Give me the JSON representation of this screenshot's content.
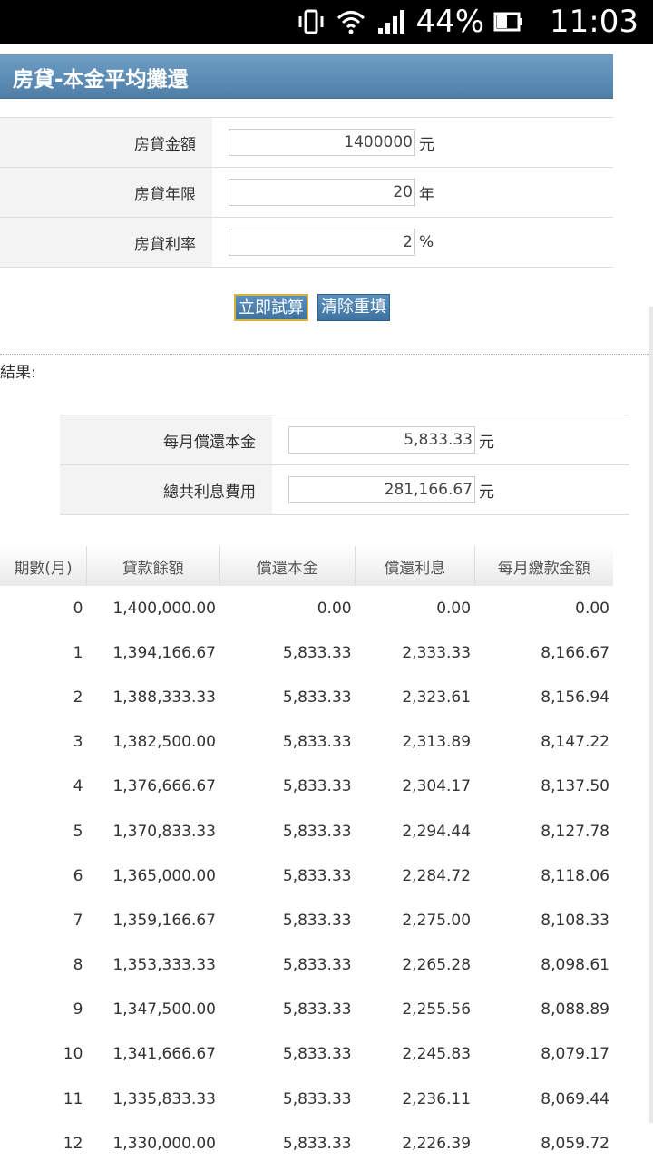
{
  "status": {
    "battery": "44%",
    "time": "11:03"
  },
  "title": "房貸-本金平均攤還",
  "form": [
    {
      "label": "房貸金額",
      "value": "1400000",
      "unit": "元"
    },
    {
      "label": "房貸年限",
      "value": "20",
      "unit": "年"
    },
    {
      "label": "房貸利率",
      "value": "2",
      "unit": "%"
    }
  ],
  "buttons": {
    "calculate": "立即試算",
    "clear": "清除重填"
  },
  "result_label": "結果:",
  "results": [
    {
      "label": "每月償還本金",
      "value": "5,833.33",
      "unit": "元"
    },
    {
      "label": "總共利息費用",
      "value": "281,166.67",
      "unit": "元"
    }
  ],
  "schedule": {
    "headers": [
      "期數(月)",
      "貸款餘額",
      "償還本金",
      "償還利息",
      "每月繳款金額"
    ],
    "rows": [
      [
        "0",
        "1,400,000.00",
        "0.00",
        "0.00",
        "0.00"
      ],
      [
        "1",
        "1,394,166.67",
        "5,833.33",
        "2,333.33",
        "8,166.67"
      ],
      [
        "2",
        "1,388,333.33",
        "5,833.33",
        "2,323.61",
        "8,156.94"
      ],
      [
        "3",
        "1,382,500.00",
        "5,833.33",
        "2,313.89",
        "8,147.22"
      ],
      [
        "4",
        "1,376,666.67",
        "5,833.33",
        "2,304.17",
        "8,137.50"
      ],
      [
        "5",
        "1,370,833.33",
        "5,833.33",
        "2,294.44",
        "8,127.78"
      ],
      [
        "6",
        "1,365,000.00",
        "5,833.33",
        "2,284.72",
        "8,118.06"
      ],
      [
        "7",
        "1,359,166.67",
        "5,833.33",
        "2,275.00",
        "8,108.33"
      ],
      [
        "8",
        "1,353,333.33",
        "5,833.33",
        "2,265.28",
        "8,098.61"
      ],
      [
        "9",
        "1,347,500.00",
        "5,833.33",
        "2,255.56",
        "8,088.89"
      ],
      [
        "10",
        "1,341,666.67",
        "5,833.33",
        "2,245.83",
        "8,079.17"
      ],
      [
        "11",
        "1,335,833.33",
        "5,833.33",
        "2,236.11",
        "8,069.44"
      ],
      [
        "12",
        "1,330,000.00",
        "5,833.33",
        "2,226.39",
        "8,059.72"
      ]
    ]
  }
}
